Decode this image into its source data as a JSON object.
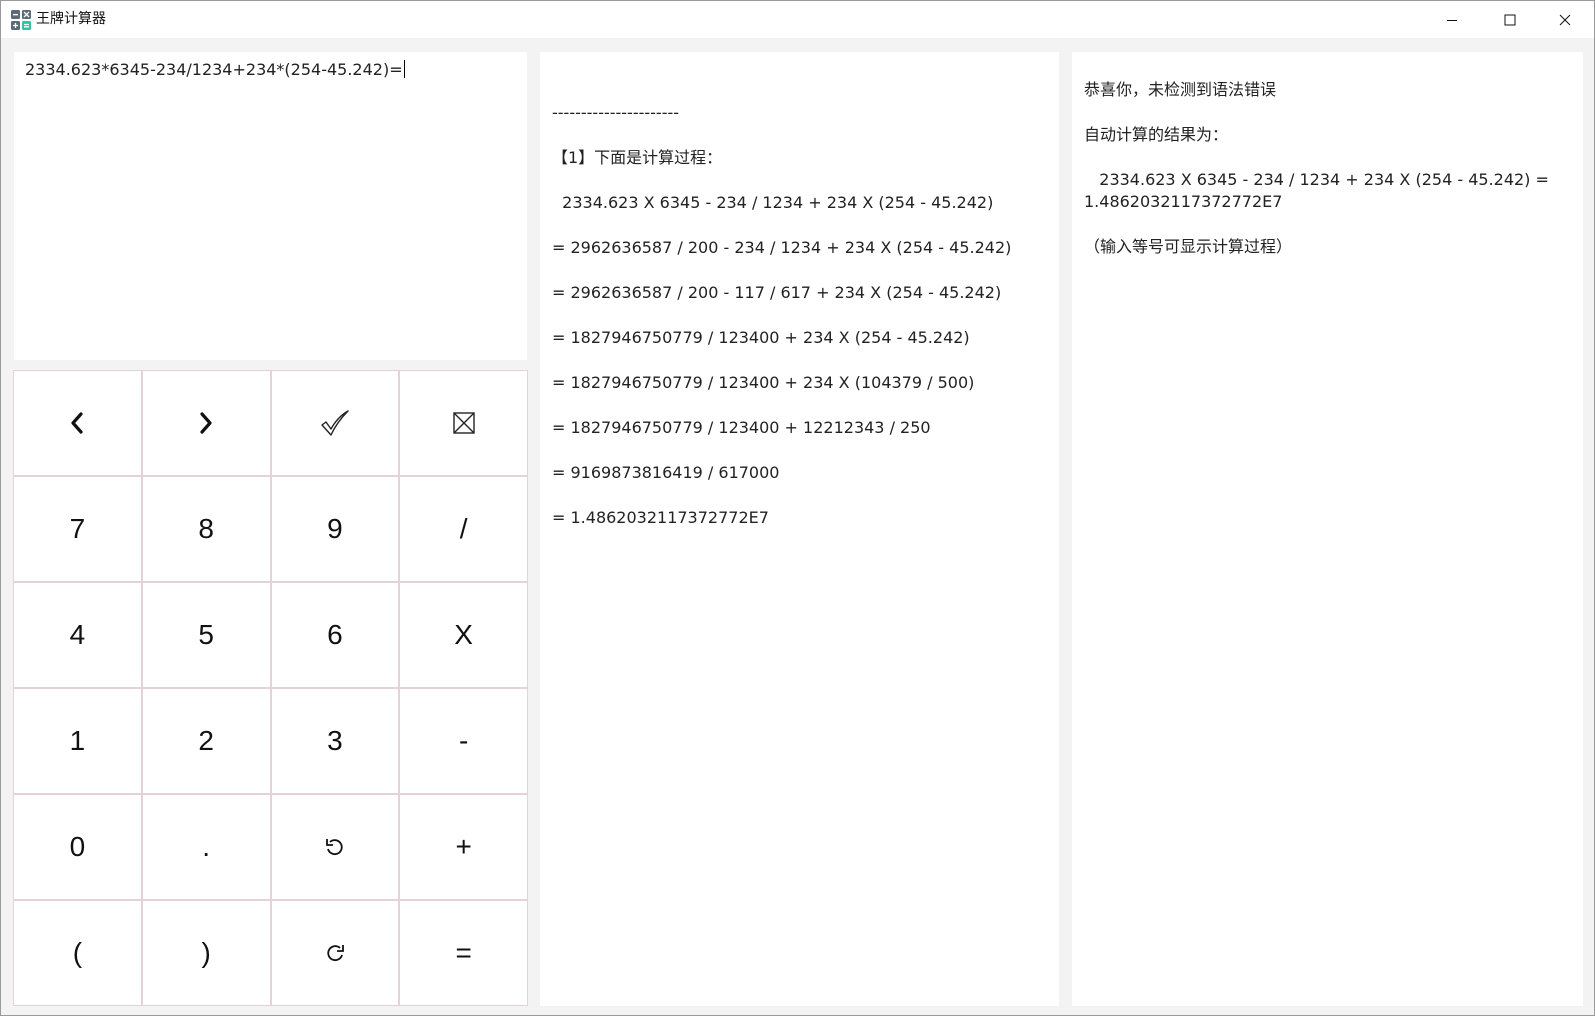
{
  "window": {
    "title": "王牌计算器"
  },
  "titlebar_buttons": {
    "minimize_icon": "minimize-icon",
    "maximize_icon": "maximize-icon",
    "close_icon": "close-icon"
  },
  "expression": {
    "value": "2334.623*6345-234/1234+234*(254-45.242)="
  },
  "keypad": {
    "keys": [
      {
        "name": "cursor-left-button",
        "icon": "chevron-left-icon",
        "label": "‹"
      },
      {
        "name": "cursor-right-button",
        "icon": "chevron-right-icon",
        "label": "›"
      },
      {
        "name": "check-syntax-button",
        "icon": "checkmark-icon",
        "label": "✓"
      },
      {
        "name": "delete-button",
        "icon": "box-x-icon",
        "label": "⊠"
      },
      {
        "name": "key-7-button",
        "label": "7"
      },
      {
        "name": "key-8-button",
        "label": "8"
      },
      {
        "name": "key-9-button",
        "label": "9"
      },
      {
        "name": "divide-button",
        "label": "/"
      },
      {
        "name": "key-4-button",
        "label": "4"
      },
      {
        "name": "key-5-button",
        "label": "5"
      },
      {
        "name": "key-6-button",
        "label": "6"
      },
      {
        "name": "multiply-button",
        "label": "X"
      },
      {
        "name": "key-1-button",
        "label": "1"
      },
      {
        "name": "key-2-button",
        "label": "2"
      },
      {
        "name": "key-3-button",
        "label": "3"
      },
      {
        "name": "subtract-button",
        "label": "-"
      },
      {
        "name": "key-0-button",
        "label": "0"
      },
      {
        "name": "decimal-point-button",
        "label": "."
      },
      {
        "name": "undo-button",
        "icon": "undo-icon",
        "label": "⟲"
      },
      {
        "name": "add-button",
        "label": "+"
      },
      {
        "name": "open-paren-button",
        "label": "("
      },
      {
        "name": "close-paren-button",
        "label": ")"
      },
      {
        "name": "redo-button",
        "icon": "redo-icon",
        "label": "⟳"
      },
      {
        "name": "equals-button",
        "label": "="
      }
    ]
  },
  "steps": {
    "lines": [
      "----------------------",
      "【1】下面是计算过程：",
      "  2334.623 X 6345 - 234 / 1234 + 234 X (254 - 45.242)",
      "= 2962636587 / 200 - 234 / 1234 + 234 X (254 - 45.242)",
      "= 2962636587 / 200 - 117 / 617 + 234 X (254 - 45.242)",
      "= 1827946750779 / 123400 + 234 X (254 - 45.242)",
      "= 1827946750779 / 123400 + 234 X (104379 / 500)",
      "= 1827946750779 / 123400 + 12212343 / 250",
      "= 9169873816419 / 617000",
      "= 1.4862032117372772E7"
    ]
  },
  "result": {
    "syntax_message": "恭喜你，未检测到语法错误",
    "result_heading": "自动计算的结果为：",
    "result_expression": "   2334.623 X 6345 - 234 / 1234 + 234 X (254 - 45.242) =",
    "result_value": "1.4862032117372772E7",
    "hint": "（输入等号可显示计算过程）"
  },
  "colors": {
    "background": "#f3f3f3",
    "panel": "#ffffff",
    "key_border": "#e3d3d6",
    "text": "#222222"
  }
}
